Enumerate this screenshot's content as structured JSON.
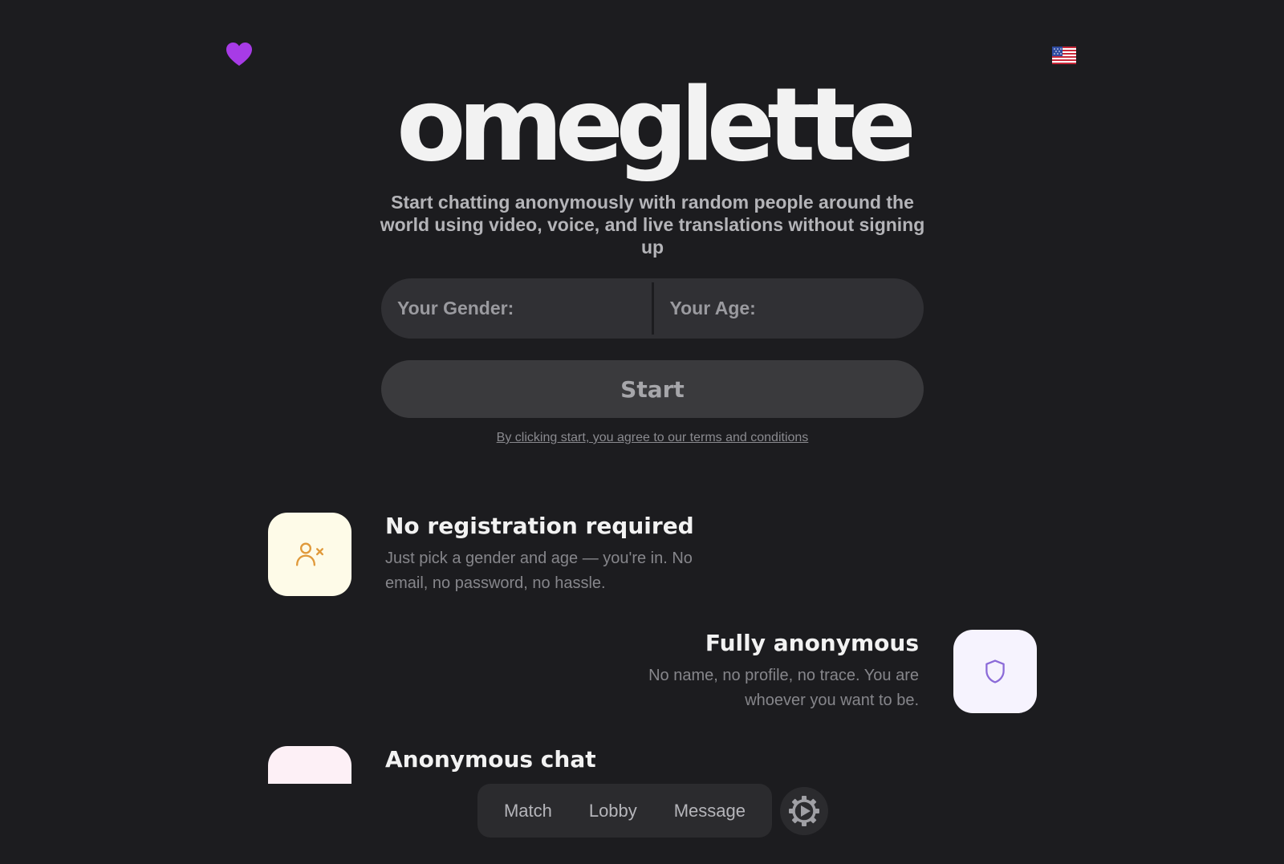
{
  "header": {
    "heart_icon": "heart-icon",
    "flag_icon": "us-flag-icon"
  },
  "hero": {
    "logo": "omeglette",
    "tagline": "Start chatting anonymously with random people around the world using video, voice, and live translations without signing up"
  },
  "form": {
    "gender_label": "Your Gender:",
    "age_label": "Your Age:",
    "start_label": "Start",
    "terms_text": "By clicking start, you agree to our terms and conditions"
  },
  "features": [
    {
      "title": "No registration required",
      "description": "Just pick a gender and age — you're in. No email, no password, no hassle.",
      "icon": "user-x-icon",
      "icon_bg": "#fefbe8",
      "icon_color": "#e0993a"
    },
    {
      "title": "Fully anonymous",
      "description": "No name, no profile, no trace. You are whoever you want to be.",
      "icon": "shield-icon",
      "icon_bg": "#f6f3fe",
      "icon_color": "#8b6ad8"
    },
    {
      "title": "Anonymous chat",
      "description": "",
      "icon": "chat-icon",
      "icon_bg": "#fdf0f6",
      "icon_color": "#d8609a"
    }
  ],
  "bottom_nav": {
    "items": [
      "Match",
      "Lobby",
      "Message"
    ],
    "settings_icon": "gear-icon"
  },
  "colors": {
    "background": "#1c1c1f",
    "accent_heart": "#a73be6",
    "input_bg": "#303034",
    "button_bg": "#3a3a3d"
  }
}
